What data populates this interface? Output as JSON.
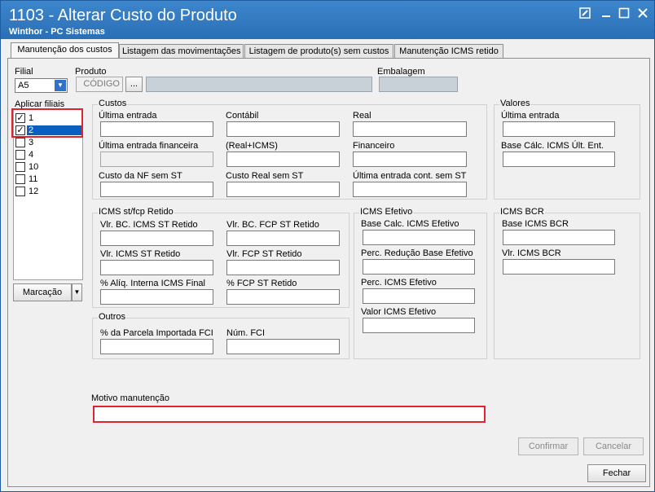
{
  "window": {
    "title": "1103 - Alterar Custo do Produto",
    "subtitle": "Winthor - PC Sistemas",
    "buttons": [
      "edit-icon",
      "minimize-icon",
      "maximize-icon",
      "close-icon"
    ]
  },
  "tabs": [
    {
      "label": "Manutenção dos custos",
      "active": true
    },
    {
      "label": "Listagem das movimentações",
      "active": false
    },
    {
      "label": "Listagem de produto(s)  sem custos",
      "active": false
    },
    {
      "label": "Manutenção ICMS retido",
      "active": false
    }
  ],
  "filial": {
    "label": "Filial",
    "value": "A5"
  },
  "produto": {
    "label": "Produto",
    "placeholder": "CÓDIGO",
    "browse": "..."
  },
  "embalagem": {
    "label": "Embalagem"
  },
  "aplicar_filiais": {
    "label": "Aplicar filiais",
    "items": [
      {
        "label": "1",
        "checked": true,
        "selected": false
      },
      {
        "label": "2",
        "checked": true,
        "selected": true
      },
      {
        "label": "3",
        "checked": false,
        "selected": false
      },
      {
        "label": "4",
        "checked": false,
        "selected": false
      },
      {
        "label": "10",
        "checked": false,
        "selected": false
      },
      {
        "label": "11",
        "checked": false,
        "selected": false
      },
      {
        "label": "12",
        "checked": false,
        "selected": false
      }
    ],
    "marcacao": "Marcação"
  },
  "custos": {
    "title": "Custos",
    "ultima_entrada": "Última entrada",
    "contabil": "Contábil",
    "real": "Real",
    "ultima_entrada_financeira": "Última entrada financeira",
    "real_icms": "(Real+ICMS)",
    "financeiro": "Financeiro",
    "custo_nf_sem_st": "Custo da NF sem ST",
    "custo_real_sem_st": "Custo Real sem ST",
    "ultima_entrada_cont_sem_st": "Última entrada cont. sem ST"
  },
  "valores": {
    "title": "Valores",
    "ultima_entrada": "Última entrada",
    "base_calc_icms": "Base Cálc. ICMS Últ. Ent."
  },
  "icms_st": {
    "title": "ICMS st/fcp Retido",
    "vlr_bc_icms_st": "Vlr. BC. ICMS ST Retido",
    "vlr_bc_fcp_st": "Vlr. BC. FCP ST Retido",
    "vlr_icms_st": "Vlr. ICMS ST Retido",
    "vlr_fcp_st": "Vlr. FCP ST Retido",
    "aliq_interna": "% Alíq. Interna ICMS Final",
    "fcp_st": "% FCP ST Retido"
  },
  "icms_efetivo": {
    "title": "ICMS Efetivo",
    "base_calc": "Base Calc. ICMS Efetivo",
    "perc_reducao": "Perc. Redução Base Efetivo",
    "perc_icms": "Perc. ICMS Efetivo",
    "valor_icms": "Valor ICMS Efetivo"
  },
  "icms_bcr": {
    "title": "ICMS BCR",
    "base": "Base ICMS BCR",
    "vlr": "Vlr. ICMS BCR"
  },
  "outros": {
    "title": "Outros",
    "parcela_importada": "% da Parcela Importada FCI",
    "num_fci": "Núm. FCI"
  },
  "motivo": {
    "label": "Motivo manutenção",
    "value": ""
  },
  "actions": {
    "confirmar": "Confirmar",
    "cancelar": "Cancelar",
    "fechar": "Fechar"
  },
  "colors": {
    "titlebar": "#2a6fb6",
    "highlight": "#e0242f",
    "selection": "#0b5fc1"
  }
}
